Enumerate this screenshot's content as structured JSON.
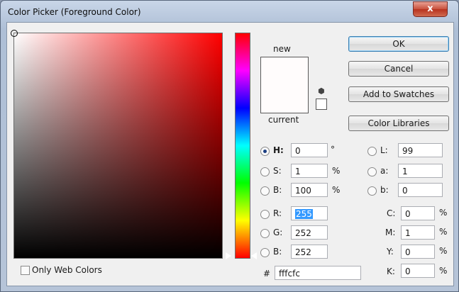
{
  "window": {
    "title": "Color Picker (Foreground Color)",
    "close_glyph": "x"
  },
  "preview": {
    "new_label": "new",
    "current_label": "current",
    "new_color": "#fffcfc"
  },
  "buttons": {
    "ok": "OK",
    "cancel": "Cancel",
    "add_swatches": "Add to Swatches",
    "libraries": "Color Libraries"
  },
  "hsb": {
    "h": {
      "label": "H:",
      "value": "0",
      "unit": "°",
      "selected": true
    },
    "s": {
      "label": "S:",
      "value": "1",
      "unit": "%"
    },
    "b": {
      "label": "B:",
      "value": "100",
      "unit": "%"
    }
  },
  "rgb": {
    "r": {
      "label": "R:",
      "value": "255"
    },
    "g": {
      "label": "G:",
      "value": "252"
    },
    "b": {
      "label": "B:",
      "value": "252"
    }
  },
  "lab": {
    "l": {
      "label": "L:",
      "value": "99"
    },
    "a": {
      "label": "a:",
      "value": "1"
    },
    "b": {
      "label": "b:",
      "value": "0"
    }
  },
  "cmyk": {
    "c": {
      "label": "C:",
      "value": "0",
      "unit": "%"
    },
    "m": {
      "label": "M:",
      "value": "1",
      "unit": "%"
    },
    "y": {
      "label": "Y:",
      "value": "0",
      "unit": "%"
    },
    "k": {
      "label": "K:",
      "value": "0",
      "unit": "%"
    }
  },
  "hex": {
    "label": "#",
    "value": "fffcfc"
  },
  "only_web_colors": {
    "label": "Only Web Colors",
    "checked": false
  },
  "icons": {
    "gamut_warning": "cube-icon",
    "web_safe": "web-safe-swatch"
  }
}
